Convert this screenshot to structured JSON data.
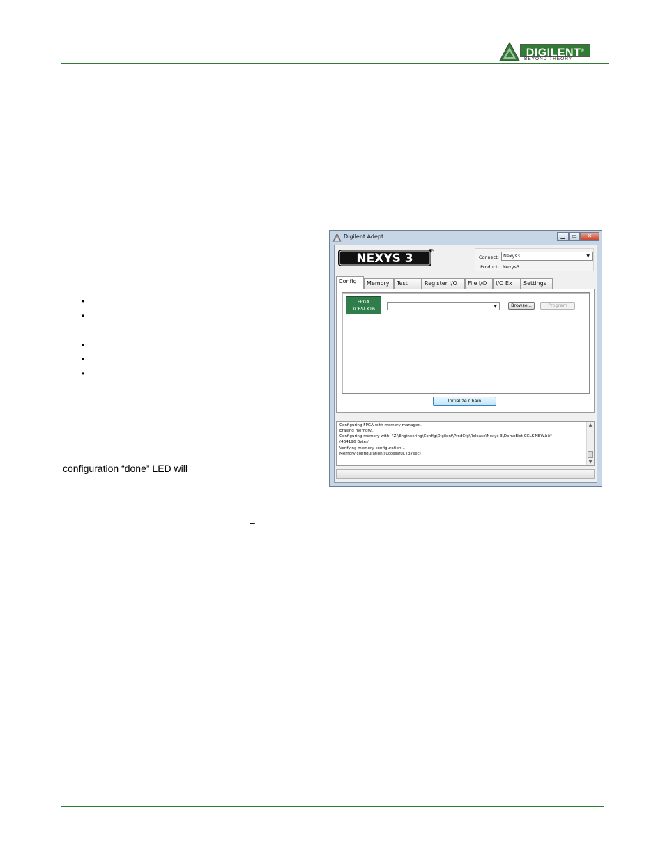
{
  "header": {
    "logo_word": "DIGILENT",
    "logo_tm": "®",
    "logo_tagline": "BEYOND THEORY"
  },
  "body": {
    "text_line": "configuration “done” LED will",
    "dash": "–"
  },
  "colors": {
    "rule": "#2e7d32",
    "brand_green": "#2f7d32",
    "fpga_green": "#2e7d4a"
  },
  "window": {
    "title": "Digilent Adept",
    "brand_logo_text": "NEXYS 3",
    "brand_tm": "TM",
    "connect_label": "Connect:",
    "connect_value": "Nexys3",
    "product_label": "Product:",
    "product_value": "Nexys3",
    "tabs": [
      "Config",
      "Memory",
      "Test",
      "Register I/O",
      "File I/O",
      "I/O Ex",
      "Settings"
    ],
    "active_tab": "Config",
    "device": {
      "name": "FPGA",
      "part": "XC6SLX16"
    },
    "browse_label": "Browse...",
    "program_label": "Program",
    "initialize_label": "Initialize Chain",
    "log_lines": [
      "Configuring FPGA with memory manager...",
      "Erasing memory...",
      "Configuring memory with:  \"Z:\\Engineering\\Config\\Digilent\\ProdCfg\\Release\\Nexys 3\\DemoBist.CCLK-NEW.bit\"",
      "(464196 Bytes)",
      "Verifying memory configuration...",
      "Memory configuration successful. (37sec)"
    ]
  }
}
